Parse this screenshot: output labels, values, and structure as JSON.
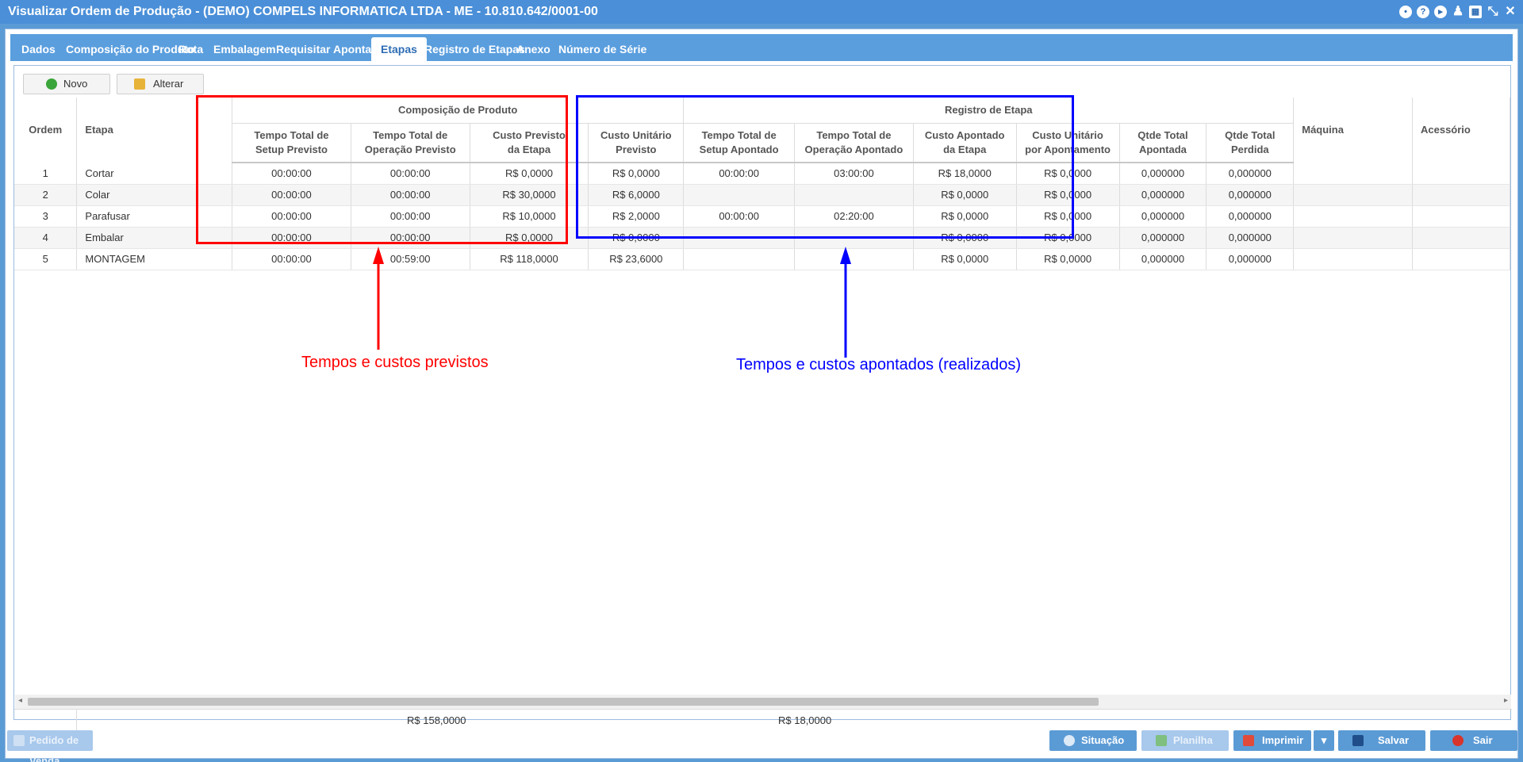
{
  "window": {
    "title": "Visualizar Ordem de Produção - (DEMO) COMPELS INFORMATICA LTDA - ME - 10.810.642/0001-00",
    "title_icons": [
      "settings-icon",
      "help-icon",
      "play-icon",
      "user-icon",
      "calendar-icon",
      "restore-icon",
      "close-icon"
    ]
  },
  "tabs": [
    {
      "label": "Dados"
    },
    {
      "label": "Composição do Produto"
    },
    {
      "label": "Rota"
    },
    {
      "label": "Embalagem"
    },
    {
      "label": "Requisitar"
    },
    {
      "label": "Apontar"
    },
    {
      "label": "Etapas",
      "active": true
    },
    {
      "label": "Registro de Etapas"
    },
    {
      "label": "Anexo"
    },
    {
      "label": "Número de Série"
    }
  ],
  "toolbar": {
    "novo": "Novo",
    "alterar": "Alterar"
  },
  "grid": {
    "groups": {
      "previsto": "Composição de Produto",
      "registro": "Registro de Etapa"
    },
    "columns": {
      "ordem": "Ordem",
      "etapa": "Etapa",
      "setup_prev_1": "Tempo Total de",
      "setup_prev_2": "Setup Previsto",
      "oper_prev_1": "Tempo Total de",
      "oper_prev_2": "Operação Previsto",
      "custo_prev_1": "Custo Previsto",
      "custo_prev_2": "da Etapa",
      "unit_prev_1": "Custo Unitário",
      "unit_prev_2": "Previsto",
      "setup_apont_1": "Tempo Total de",
      "setup_apont_2": "Setup Apontado",
      "oper_apont_1": "Tempo Total de",
      "oper_apont_2": "Operação Apontado",
      "custo_apont_1": "Custo Apontado",
      "custo_apont_2": "da Etapa",
      "unit_apont_1": "Custo Unitário",
      "unit_apont_2": "por Apontamento",
      "qtde_apont_1": "Qtde Total",
      "qtde_apont_2": "Apontada",
      "qtde_perd_1": "Qtde Total",
      "qtde_perd_2": "Perdida",
      "maquina": "Máquina",
      "acessorio": "Acessório"
    },
    "rows": [
      {
        "ordem": "1",
        "etapa": "Cortar",
        "setup_prev": "00:00:00",
        "oper_prev": "00:00:00",
        "custo_prev": "R$ 0,0000",
        "unit_prev": "R$ 0,0000",
        "setup_apont": "00:00:00",
        "oper_apont": "03:00:00",
        "custo_apont": "R$ 18,0000",
        "unit_apont": "R$ 0,0000",
        "qtde_apont": "0,000000",
        "qtde_perd": "0,000000",
        "maquina": "",
        "acessorio": ""
      },
      {
        "ordem": "2",
        "etapa": "Colar",
        "setup_prev": "00:00:00",
        "oper_prev": "00:00:00",
        "custo_prev": "R$ 30,0000",
        "unit_prev": "R$ 6,0000",
        "setup_apont": "",
        "oper_apont": "",
        "custo_apont": "R$ 0,0000",
        "unit_apont": "R$ 0,0000",
        "qtde_apont": "0,000000",
        "qtde_perd": "0,000000",
        "maquina": "",
        "acessorio": ""
      },
      {
        "ordem": "3",
        "etapa": "Parafusar",
        "setup_prev": "00:00:00",
        "oper_prev": "00:00:00",
        "custo_prev": "R$ 10,0000",
        "unit_prev": "R$ 2,0000",
        "setup_apont": "00:00:00",
        "oper_apont": "02:20:00",
        "custo_apont": "R$ 0,0000",
        "unit_apont": "R$ 0,0000",
        "qtde_apont": "0,000000",
        "qtde_perd": "0,000000",
        "maquina": "",
        "acessorio": ""
      },
      {
        "ordem": "4",
        "etapa": "Embalar",
        "setup_prev": "00:00:00",
        "oper_prev": "00:00:00",
        "custo_prev": "R$ 0,0000",
        "unit_prev": "R$ 0,0000",
        "setup_apont": "",
        "oper_apont": "",
        "custo_apont": "R$ 0,0000",
        "unit_apont": "R$ 0,0000",
        "qtde_apont": "0,000000",
        "qtde_perd": "0,000000",
        "maquina": "",
        "acessorio": ""
      },
      {
        "ordem": "5",
        "etapa": "MONTAGEM",
        "setup_prev": "00:00:00",
        "oper_prev": "00:59:00",
        "custo_prev": "R$ 118,0000",
        "unit_prev": "R$ 23,6000",
        "setup_apont": "",
        "oper_apont": "",
        "custo_apont": "R$ 0,0000",
        "unit_apont": "R$ 0,0000",
        "qtde_apont": "0,000000",
        "qtde_perd": "0,000000",
        "maquina": "",
        "acessorio": ""
      }
    ],
    "totals": {
      "custo_prev": "R$ 158,0000",
      "custo_apont": "R$ 18,0000"
    }
  },
  "annotations": {
    "previstos": "Tempos e custos previstos",
    "apontados": "Tempos e custos apontados (realizados)",
    "red_color": "#ff0000",
    "blue_color": "#0000ff"
  },
  "footer": {
    "pedido": "Pedido de Venda",
    "situacao": "Situação",
    "planilha": "Planilha",
    "imprimir": "Imprimir",
    "salvar": "Salvar",
    "sair": "Sair"
  }
}
